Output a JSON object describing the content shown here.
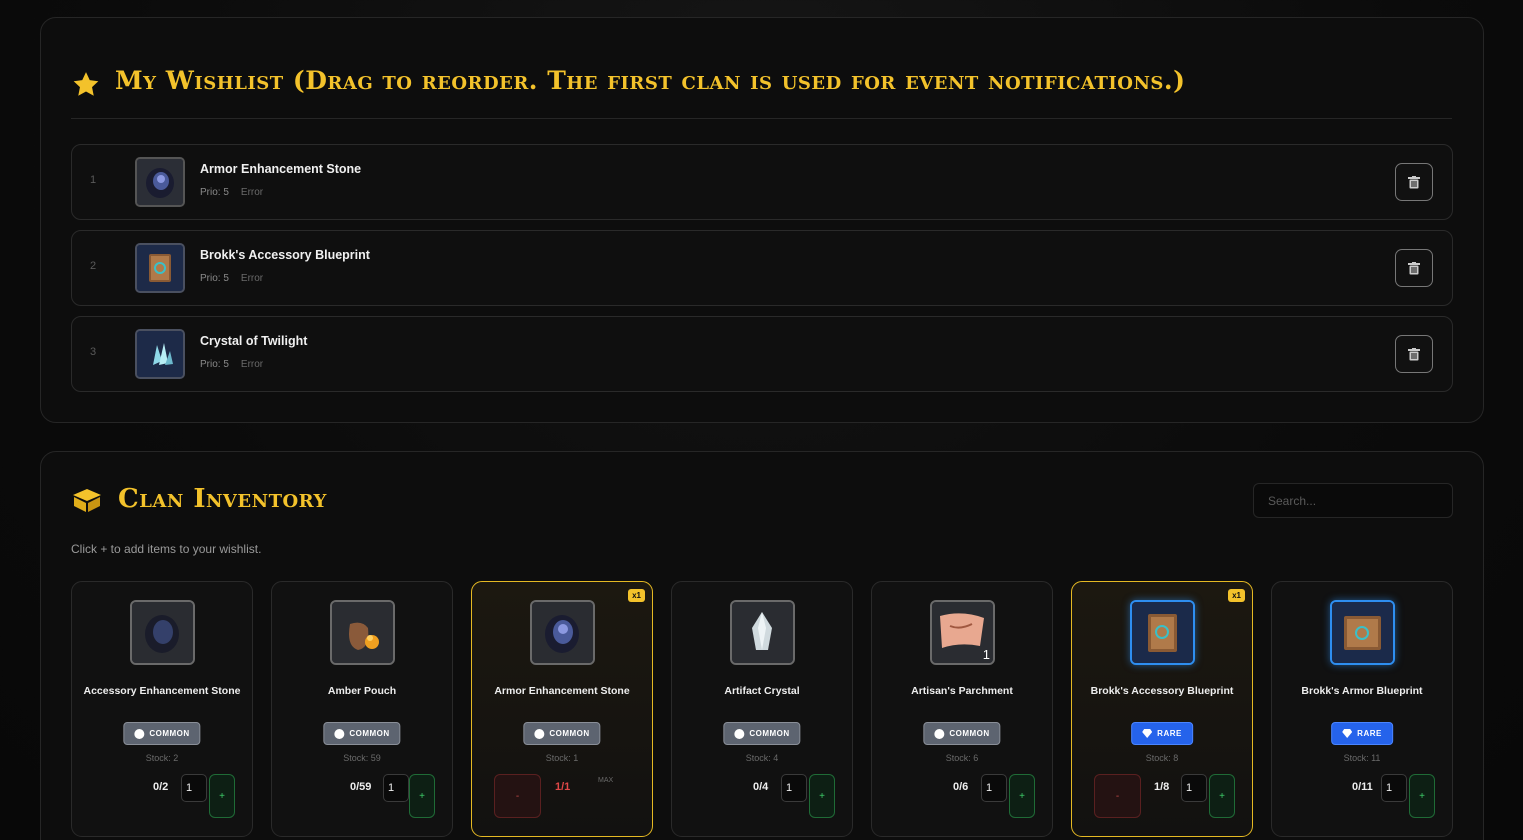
{
  "wishlist": {
    "title": "My Wishlist (Drag to reorder. The first clan is used for event notifications.)",
    "items": [
      {
        "num": "1",
        "name": "Armor Enhancement Stone",
        "prio": "Prio: 5",
        "status": "Error",
        "icon": "stone-icon"
      },
      {
        "num": "2",
        "name": "Brokk's Accessory Blueprint",
        "prio": "Prio: 5",
        "status": "Error",
        "icon": "blueprint-icon"
      },
      {
        "num": "3",
        "name": "Crystal of Twilight",
        "prio": "Prio: 5",
        "status": "Error",
        "icon": "crystal-icon"
      }
    ]
  },
  "inventory": {
    "title": "Clan Inventory",
    "search_placeholder": "Search...",
    "hint": "Click + to add items to your wishlist.",
    "cards": [
      {
        "name": "Accessory Enhancement Stone",
        "rarity": "COMMON",
        "stock": "Stock: 2",
        "count": "0/2",
        "qty": "1",
        "selected": false
      },
      {
        "name": "Amber Pouch",
        "rarity": "COMMON",
        "stock": "Stock: 59",
        "count": "0/59",
        "qty": "1",
        "selected": false
      },
      {
        "name": "Armor Enhancement Stone",
        "rarity": "COMMON",
        "stock": "Stock: 1",
        "count": "1/1",
        "badge": "x1",
        "max": "MAX",
        "selected": true
      },
      {
        "name": "Artifact Crystal",
        "rarity": "COMMON",
        "stock": "Stock: 4",
        "count": "0/4",
        "qty": "1",
        "selected": false
      },
      {
        "name": "Artisan's Parchment",
        "rarity": "COMMON",
        "stock": "Stock: 6",
        "count": "0/6",
        "qty": "1",
        "thumb_number": "1",
        "selected": false
      },
      {
        "name": "Brokk's Accessory Blueprint",
        "rarity": "RARE",
        "stock": "Stock: 8",
        "count": "1/8",
        "qty": "1",
        "badge": "x1",
        "selected": true
      },
      {
        "name": "Brokk's Armor Blueprint",
        "rarity": "RARE",
        "stock": "Stock: 11",
        "count": "0/11",
        "qty": "1",
        "selected": false
      }
    ],
    "plus_label": "+",
    "minus_label": "-"
  },
  "colors": {
    "accent_gold": "#f3c22b",
    "rare_blue": "#2563eb",
    "common_gray": "#5d6470",
    "add_green": "#3ecf6a",
    "remove_red": "#c04848"
  }
}
